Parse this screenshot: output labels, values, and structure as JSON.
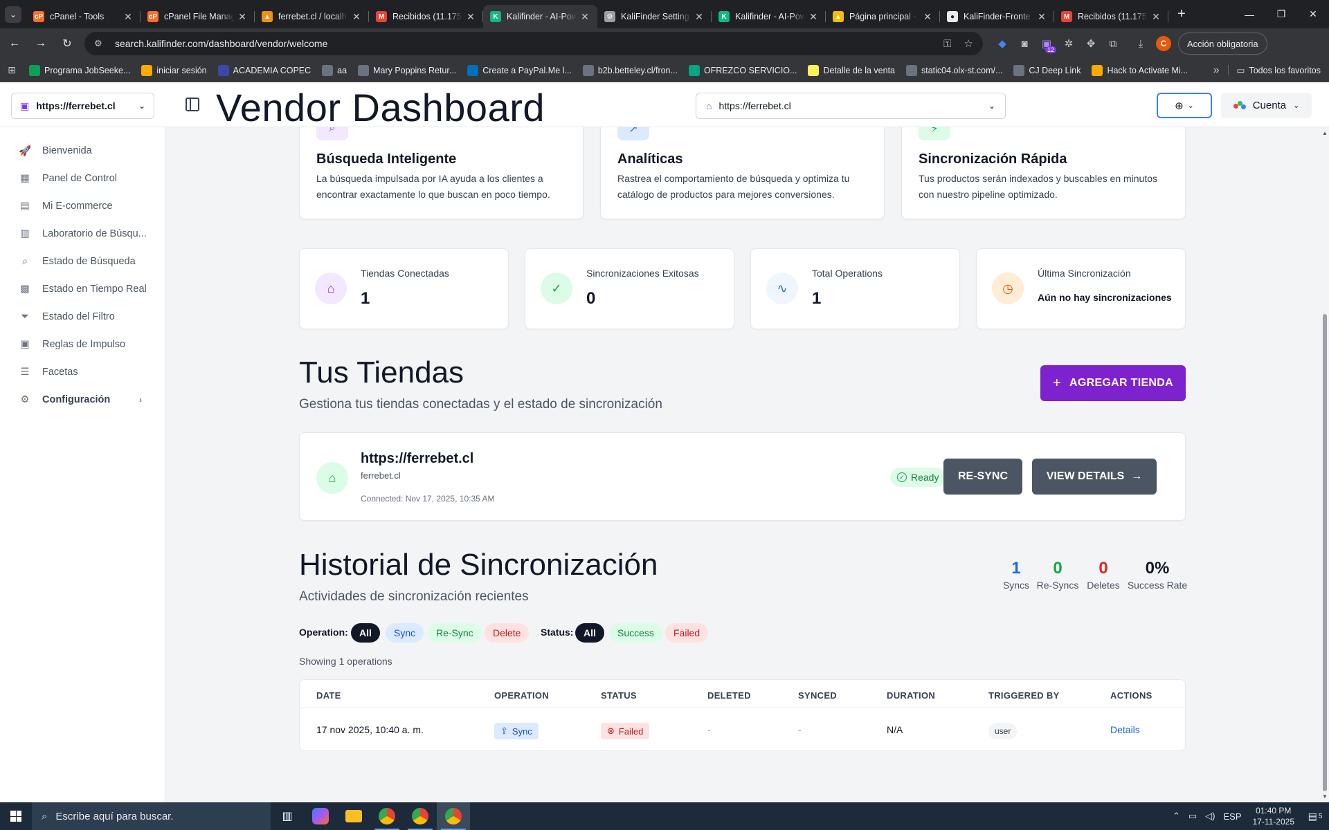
{
  "browser": {
    "tabs": [
      {
        "title": "cPanel - Tools",
        "color": "#ff6c2c",
        "glyph": "cP"
      },
      {
        "title": "cPanel File Manag",
        "color": "#ff6c2c",
        "glyph": "cP"
      },
      {
        "title": "ferrebet.cl / localh",
        "color": "#f29111",
        "glyph": "▲"
      },
      {
        "title": "Recibidos (11.175",
        "color": "#ea4335",
        "glyph": "M"
      },
      {
        "title": "Kalifinder - AI-Pow",
        "color": "#10b981",
        "glyph": "K"
      },
      {
        "title": "KaliFinder Setting",
        "color": "#9aa0a6",
        "glyph": "⚙"
      },
      {
        "title": "Kalifinder - AI-Pow",
        "color": "#10b981",
        "glyph": "K"
      },
      {
        "title": "Página principal -",
        "color": "#fbbc04",
        "glyph": "▲"
      },
      {
        "title": "KaliFinder-Fronte",
        "color": "#e8eaed",
        "glyph": "●"
      },
      {
        "title": "Recibidos (11.175",
        "color": "#ea4335",
        "glyph": "M"
      }
    ],
    "active_tab": 4,
    "url": "search.kalifinder.com/dashboard/vendor/welcome",
    "extension_badge": "12",
    "profile_initial": "C",
    "action_required": "Acción obligatoria",
    "bookmarks": [
      {
        "label": "Programa JobSeeke...",
        "color": "#0f9d58"
      },
      {
        "label": "iniciar sesión",
        "color": "#f9ab00"
      },
      {
        "label": "ACADEMIA COPEC",
        "color": "#3949ab"
      },
      {
        "label": "aa",
        "color": "#6b7280"
      },
      {
        "label": "Mary Poppins Retur...",
        "color": "#6b7280"
      },
      {
        "label": "Create a PayPal.Me l...",
        "color": "#0070ba"
      },
      {
        "label": "b2b.betteley.cl/fron...",
        "color": "#6b7280"
      },
      {
        "label": "OFREZCO SERVICIO...",
        "color": "#00a884"
      },
      {
        "label": "Detalle de la venta",
        "color": "#fff159"
      },
      {
        "label": "static04.olx-st.com/...",
        "color": "#6b7280"
      },
      {
        "label": "CJ Deep Link",
        "color": "#6b7280"
      },
      {
        "label": "Hack to Activate Mi...",
        "color": "#f9ab00"
      }
    ],
    "bookmarks_all": "Todos los favoritos"
  },
  "header": {
    "store_select": "https://ferrebet.cl",
    "title": "Vendor Dashboard",
    "url_select": "https://ferrebet.cl",
    "account": "Cuenta"
  },
  "sidebar": {
    "items": [
      {
        "label": "Bienvenida",
        "icon": "rocket-icon",
        "glyph": "🚀"
      },
      {
        "label": "Panel de Control",
        "icon": "dashboard-icon",
        "glyph": "▦"
      },
      {
        "label": "Mi E-commerce",
        "icon": "store-icon",
        "glyph": "▤"
      },
      {
        "label": "Laboratorio de Búsqu...",
        "icon": "lab-icon",
        "glyph": "▥"
      },
      {
        "label": "Estado de Búsqueda",
        "icon": "search-icon",
        "glyph": "⌕"
      },
      {
        "label": "Estado en Tiempo Real",
        "icon": "realtime-icon",
        "glyph": "▩"
      },
      {
        "label": "Estado del Filtro",
        "icon": "filter-icon",
        "glyph": "⏷"
      },
      {
        "label": "Reglas de Impulso",
        "icon": "rules-icon",
        "glyph": "▣"
      },
      {
        "label": "Facetas",
        "icon": "list-icon",
        "glyph": "☰"
      },
      {
        "label": "Configuración",
        "icon": "gear-icon",
        "glyph": "⚙"
      }
    ]
  },
  "features": [
    {
      "title": "Búsqueda Inteligente",
      "desc": "La búsqueda impulsada por IA ayuda a los clientes a encontrar exactamente lo que buscan en poco tiempo.",
      "glyph": "⌕",
      "bg": "#f3e8ff",
      "fg": "#7c3aed"
    },
    {
      "title": "Analíticas",
      "desc": "Rastrea el comportamiento de búsqueda y optimiza tu catálogo de productos para mejores conversiones.",
      "glyph": "↗",
      "bg": "#dbeafe",
      "fg": "#2563eb"
    },
    {
      "title": "Sincronización Rápida",
      "desc": "Tus productos serán indexados y buscables en minutos con nuestro pipeline optimizado.",
      "glyph": "⚡",
      "bg": "#dcfce7",
      "fg": "#16a34a"
    }
  ],
  "stats": [
    {
      "label": "Tiendas Conectadas",
      "value": "1",
      "glyph": "⌂",
      "bg": "#f3e8ff",
      "fg": "#7c3aed"
    },
    {
      "label": "Sincronizaciones Exitosas",
      "value": "0",
      "glyph": "✓",
      "bg": "#dcfce7",
      "fg": "#16a34a"
    },
    {
      "label": "Total Operations",
      "value": "1",
      "glyph": "∿",
      "bg": "#eff6ff",
      "fg": "#2563eb"
    },
    {
      "label": "Última Sincronización",
      "value": "Aún no hay sincronizaciones",
      "glyph": "◷",
      "bg": "#ffedd5",
      "fg": "#ea580c"
    }
  ],
  "stores": {
    "title": "Tus Tiendas",
    "subtitle": "Gestiona tus tiendas conectadas y el estado de sincronización",
    "add_button": "AGREGAR TIENDA",
    "store": {
      "name": "https://ferrebet.cl",
      "domain": "ferrebet.cl",
      "connected": "Connected: Nov 17, 2025, 10:35 AM",
      "status": "Ready",
      "resync": "RE-SYNC",
      "details": "VIEW DETAILS"
    }
  },
  "history": {
    "title": "Historial de Sincronización",
    "subtitle": "Actividades de sincronización recientes",
    "summary": [
      {
        "value": "1",
        "label": "Syncs",
        "color": "#2563eb"
      },
      {
        "value": "0",
        "label": "Re-Syncs",
        "color": "#16a34a"
      },
      {
        "value": "0",
        "label": "Deletes",
        "color": "#dc2626"
      },
      {
        "value": "0%",
        "label": "Success Rate",
        "color": "#111827"
      }
    ],
    "operation_label": "Operation:",
    "operation_filters": [
      "All",
      "Sync",
      "Re-Sync",
      "Delete"
    ],
    "status_label": "Status:",
    "status_filters": [
      "All",
      "Success",
      "Failed"
    ],
    "showing": "Showing 1 operations",
    "columns": [
      "DATE",
      "OPERATION",
      "STATUS",
      "DELETED",
      "SYNCED",
      "DURATION",
      "TRIGGERED BY",
      "ACTIONS"
    ],
    "rows": [
      {
        "date": "17 nov 2025, 10:40 a. m.",
        "operation": "Sync",
        "status": "Failed",
        "deleted": "-",
        "synced": "-",
        "duration": "N/A",
        "triggered_by": "user",
        "action": "Details"
      }
    ]
  },
  "taskbar": {
    "search_placeholder": "Escribe aquí para buscar.",
    "lang": "ESP",
    "time": "01:40 PM",
    "date": "17-11-2025",
    "notifications": "5"
  }
}
